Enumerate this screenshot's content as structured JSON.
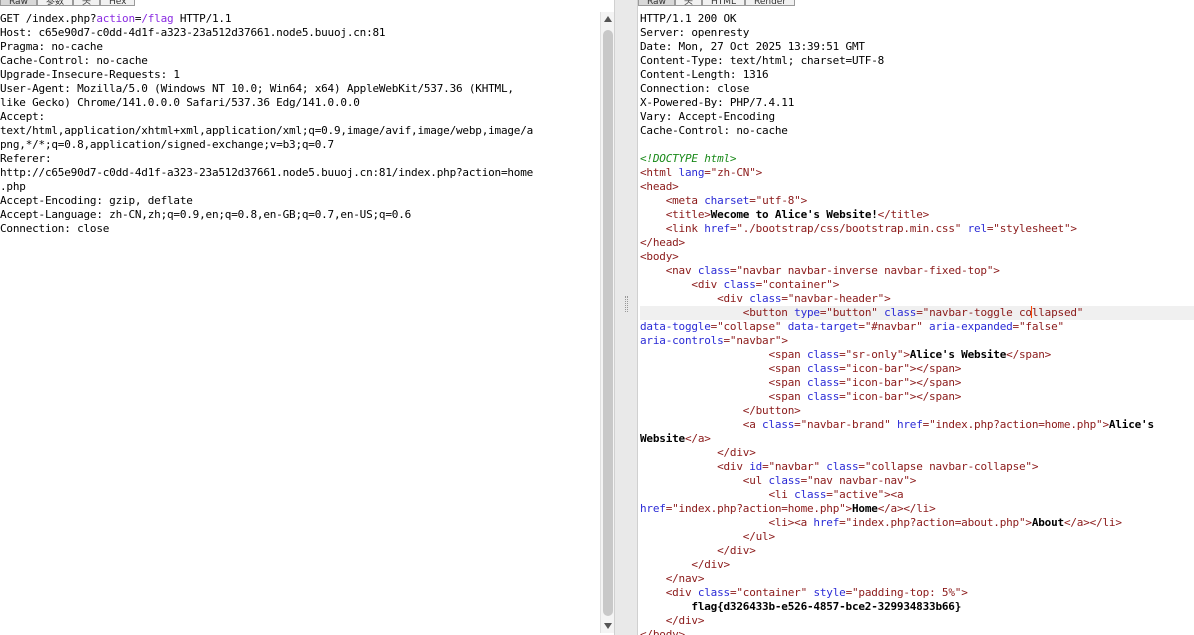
{
  "request_tabs": [
    "Raw",
    "参数",
    "头",
    "Hex"
  ],
  "response_tabs": [
    "Raw",
    "头",
    "HTML",
    "Render"
  ],
  "request_lines": [
    {
      "segments": [
        {
          "t": "GET /index.php?"
        },
        {
          "t": "action",
          "c": "param"
        },
        {
          "t": "="
        },
        {
          "t": "/flag",
          "c": "param"
        },
        {
          "t": " HTTP/1.1"
        }
      ]
    },
    {
      "segments": [
        {
          "t": "Host: c65e90d7-c0dd-4d1f-a323-23a512d37661.node5.buuoj.cn:81"
        }
      ]
    },
    {
      "segments": [
        {
          "t": "Pragma: no-cache"
        }
      ]
    },
    {
      "segments": [
        {
          "t": "Cache-Control: no-cache"
        }
      ]
    },
    {
      "segments": [
        {
          "t": "Upgrade-Insecure-Requests: 1"
        }
      ]
    },
    {
      "segments": [
        {
          "t": "User-Agent: Mozilla/5.0 (Windows NT 10.0; Win64; x64) AppleWebKit/537.36 (KHTML,"
        }
      ]
    },
    {
      "segments": [
        {
          "t": "like Gecko) Chrome/141.0.0.0 Safari/537.36 Edg/141.0.0.0"
        }
      ]
    },
    {
      "segments": [
        {
          "t": "Accept:"
        }
      ]
    },
    {
      "segments": [
        {
          "t": "text/html,application/xhtml+xml,application/xml;q=0.9,image/avif,image/webp,image/a"
        }
      ]
    },
    {
      "segments": [
        {
          "t": "png,*/*;q=0.8,application/signed-exchange;v=b3;q=0.7"
        }
      ]
    },
    {
      "segments": [
        {
          "t": "Referer:"
        }
      ]
    },
    {
      "segments": [
        {
          "t": "http://c65e90d7-c0dd-4d1f-a323-23a512d37661.node5.buuoj.cn:81/index.php?action=home"
        }
      ]
    },
    {
      "segments": [
        {
          "t": ".php"
        }
      ]
    },
    {
      "segments": [
        {
          "t": "Accept-Encoding: gzip, deflate"
        }
      ]
    },
    {
      "segments": [
        {
          "t": "Accept-Language: zh-CN,zh;q=0.9,en;q=0.8,en-GB;q=0.7,en-US;q=0.6"
        }
      ]
    },
    {
      "segments": [
        {
          "t": "Connection: close"
        }
      ]
    }
  ],
  "response_lines": [
    {
      "segments": [
        {
          "t": "HTTP/1.1 200 OK"
        }
      ]
    },
    {
      "segments": [
        {
          "t": "Server: openresty"
        }
      ]
    },
    {
      "segments": [
        {
          "t": "Date: Mon, 27 Oct 2025 13:39:51 GMT"
        }
      ]
    },
    {
      "segments": [
        {
          "t": "Content-Type: text/html; charset=UTF-8"
        }
      ]
    },
    {
      "segments": [
        {
          "t": "Content-Length: 1316"
        }
      ]
    },
    {
      "segments": [
        {
          "t": "Connection: close"
        }
      ]
    },
    {
      "segments": [
        {
          "t": "X-Powered-By: PHP/7.4.11"
        }
      ]
    },
    {
      "segments": [
        {
          "t": "Vary: Accept-Encoding"
        }
      ]
    },
    {
      "segments": [
        {
          "t": "Cache-Control: no-cache"
        }
      ]
    },
    {
      "segments": [
        {
          "t": ""
        }
      ]
    },
    {
      "segments": [
        {
          "t": "<!DOCTYPE html>",
          "c": "doctype"
        }
      ]
    },
    {
      "segments": [
        {
          "t": "<html ",
          "c": "tag"
        },
        {
          "t": "lang",
          "c": "attr"
        },
        {
          "t": "=\"zh-CN\"",
          "c": "str"
        },
        {
          "t": ">",
          "c": "tag"
        }
      ]
    },
    {
      "segments": [
        {
          "t": "<head>",
          "c": "tag"
        }
      ]
    },
    {
      "segments": [
        {
          "t": "    "
        },
        {
          "t": "<meta ",
          "c": "tag"
        },
        {
          "t": "charset",
          "c": "attr"
        },
        {
          "t": "=\"utf-8\"",
          "c": "str"
        },
        {
          "t": ">",
          "c": "tag"
        }
      ]
    },
    {
      "segments": [
        {
          "t": "    "
        },
        {
          "t": "<title>",
          "c": "tag"
        },
        {
          "t": "Wecome to Alice's Website!",
          "c": "bold"
        },
        {
          "t": "</title>",
          "c": "tag"
        }
      ]
    },
    {
      "segments": [
        {
          "t": "    "
        },
        {
          "t": "<link ",
          "c": "tag"
        },
        {
          "t": "href",
          "c": "attr"
        },
        {
          "t": "=\"./bootstrap/css/bootstrap.min.css\" ",
          "c": "str"
        },
        {
          "t": "rel",
          "c": "attr"
        },
        {
          "t": "=\"stylesheet\"",
          "c": "str"
        },
        {
          "t": ">",
          "c": "tag"
        }
      ]
    },
    {
      "segments": [
        {
          "t": "</head>",
          "c": "tag"
        }
      ]
    },
    {
      "segments": [
        {
          "t": "<body>",
          "c": "tag"
        }
      ]
    },
    {
      "segments": [
        {
          "t": "    "
        },
        {
          "t": "<nav ",
          "c": "tag"
        },
        {
          "t": "class",
          "c": "attr"
        },
        {
          "t": "=\"navbar navbar-inverse navbar-fixed-top\"",
          "c": "str"
        },
        {
          "t": ">",
          "c": "tag"
        }
      ]
    },
    {
      "segments": [
        {
          "t": "        "
        },
        {
          "t": "<div ",
          "c": "tag"
        },
        {
          "t": "class",
          "c": "attr"
        },
        {
          "t": "=\"container\"",
          "c": "str"
        },
        {
          "t": ">",
          "c": "tag"
        }
      ]
    },
    {
      "segments": [
        {
          "t": "            "
        },
        {
          "t": "<div ",
          "c": "tag"
        },
        {
          "t": "class",
          "c": "attr"
        },
        {
          "t": "=\"navbar-header\"",
          "c": "str"
        },
        {
          "t": ">",
          "c": "tag"
        }
      ]
    },
    {
      "hl": true,
      "segments": [
        {
          "t": "                "
        },
        {
          "t": "<button ",
          "c": "tag"
        },
        {
          "t": "type",
          "c": "attr"
        },
        {
          "t": "=\"button\" ",
          "c": "str"
        },
        {
          "t": "class",
          "c": "attr"
        },
        {
          "t": "=\"navbar-toggle co",
          "c": "str"
        },
        {
          "caret": true
        },
        {
          "t": "llapsed\"",
          "c": "str"
        }
      ]
    },
    {
      "segments": [
        {
          "t": "data-toggle",
          "c": "attr"
        },
        {
          "t": "=\"collapse\" ",
          "c": "str"
        },
        {
          "t": "data-target",
          "c": "attr"
        },
        {
          "t": "=\"#navbar\" ",
          "c": "str"
        },
        {
          "t": "aria-expanded",
          "c": "attr"
        },
        {
          "t": "=\"false\"",
          "c": "str"
        }
      ]
    },
    {
      "segments": [
        {
          "t": "aria-controls",
          "c": "attr"
        },
        {
          "t": "=\"navbar\"",
          "c": "str"
        },
        {
          "t": ">",
          "c": "tag"
        }
      ]
    },
    {
      "segments": [
        {
          "t": "                    "
        },
        {
          "t": "<span ",
          "c": "tag"
        },
        {
          "t": "class",
          "c": "attr"
        },
        {
          "t": "=\"sr-only\"",
          "c": "str"
        },
        {
          "t": ">",
          "c": "tag"
        },
        {
          "t": "Alice's Website",
          "c": "bold"
        },
        {
          "t": "</span>",
          "c": "tag"
        }
      ]
    },
    {
      "segments": [
        {
          "t": "                    "
        },
        {
          "t": "<span ",
          "c": "tag"
        },
        {
          "t": "class",
          "c": "attr"
        },
        {
          "t": "=\"icon-bar\"",
          "c": "str"
        },
        {
          "t": "></span>",
          "c": "tag"
        }
      ]
    },
    {
      "segments": [
        {
          "t": "                    "
        },
        {
          "t": "<span ",
          "c": "tag"
        },
        {
          "t": "class",
          "c": "attr"
        },
        {
          "t": "=\"icon-bar\"",
          "c": "str"
        },
        {
          "t": "></span>",
          "c": "tag"
        }
      ]
    },
    {
      "segments": [
        {
          "t": "                    "
        },
        {
          "t": "<span ",
          "c": "tag"
        },
        {
          "t": "class",
          "c": "attr"
        },
        {
          "t": "=\"icon-bar\"",
          "c": "str"
        },
        {
          "t": "></span>",
          "c": "tag"
        }
      ]
    },
    {
      "segments": [
        {
          "t": "                "
        },
        {
          "t": "</button>",
          "c": "tag"
        }
      ]
    },
    {
      "segments": [
        {
          "t": "                "
        },
        {
          "t": "<a ",
          "c": "tag"
        },
        {
          "t": "class",
          "c": "attr"
        },
        {
          "t": "=\"navbar-brand\" ",
          "c": "str"
        },
        {
          "t": "href",
          "c": "attr"
        },
        {
          "t": "=\"index.php?action=home.php\"",
          "c": "str"
        },
        {
          "t": ">",
          "c": "tag"
        },
        {
          "t": "Alice's",
          "c": "bold"
        }
      ]
    },
    {
      "segments": [
        {
          "t": "Website",
          "c": "bold"
        },
        {
          "t": "</a>",
          "c": "tag"
        }
      ]
    },
    {
      "segments": [
        {
          "t": "            "
        },
        {
          "t": "</div>",
          "c": "tag"
        }
      ]
    },
    {
      "segments": [
        {
          "t": "            "
        },
        {
          "t": "<div ",
          "c": "tag"
        },
        {
          "t": "id",
          "c": "attr"
        },
        {
          "t": "=\"navbar\" ",
          "c": "str"
        },
        {
          "t": "class",
          "c": "attr"
        },
        {
          "t": "=\"collapse navbar-collapse\"",
          "c": "str"
        },
        {
          "t": ">",
          "c": "tag"
        }
      ]
    },
    {
      "segments": [
        {
          "t": "                "
        },
        {
          "t": "<ul ",
          "c": "tag"
        },
        {
          "t": "class",
          "c": "attr"
        },
        {
          "t": "=\"nav navbar-nav\"",
          "c": "str"
        },
        {
          "t": ">",
          "c": "tag"
        }
      ]
    },
    {
      "segments": [
        {
          "t": "                    "
        },
        {
          "t": "<li ",
          "c": "tag"
        },
        {
          "t": "class",
          "c": "attr"
        },
        {
          "t": "=\"active\"",
          "c": "str"
        },
        {
          "t": "><a",
          "c": "tag"
        }
      ]
    },
    {
      "segments": [
        {
          "t": "href",
          "c": "attr"
        },
        {
          "t": "=\"index.php?action=home.php\"",
          "c": "str"
        },
        {
          "t": ">",
          "c": "tag"
        },
        {
          "t": "Home",
          "c": "bold"
        },
        {
          "t": "</a></li>",
          "c": "tag"
        }
      ]
    },
    {
      "segments": [
        {
          "t": "                    "
        },
        {
          "t": "<li><a ",
          "c": "tag"
        },
        {
          "t": "href",
          "c": "attr"
        },
        {
          "t": "=\"index.php?action=about.php\"",
          "c": "str"
        },
        {
          "t": ">",
          "c": "tag"
        },
        {
          "t": "About",
          "c": "bold"
        },
        {
          "t": "</a></li>",
          "c": "tag"
        }
      ]
    },
    {
      "segments": [
        {
          "t": "                "
        },
        {
          "t": "</ul>",
          "c": "tag"
        }
      ]
    },
    {
      "segments": [
        {
          "t": "            "
        },
        {
          "t": "</div>",
          "c": "tag"
        }
      ]
    },
    {
      "segments": [
        {
          "t": "        "
        },
        {
          "t": "</div>",
          "c": "tag"
        }
      ]
    },
    {
      "segments": [
        {
          "t": "    "
        },
        {
          "t": "</nav>",
          "c": "tag"
        }
      ]
    },
    {
      "segments": [
        {
          "t": "    "
        },
        {
          "t": "<div ",
          "c": "tag"
        },
        {
          "t": "class",
          "c": "attr"
        },
        {
          "t": "=\"container\" ",
          "c": "str"
        },
        {
          "t": "style",
          "c": "attr"
        },
        {
          "t": "=\"padding-top: 5%\"",
          "c": "str"
        },
        {
          "t": ">",
          "c": "tag"
        }
      ]
    },
    {
      "segments": [
        {
          "t": "        "
        },
        {
          "t": "flag{d326433b-e526-4857-bce2-329934833b66}",
          "c": "bold"
        }
      ]
    },
    {
      "segments": [
        {
          "t": "    "
        },
        {
          "t": "</div>",
          "c": "tag"
        }
      ]
    },
    {
      "segments": [
        {
          "t": "</body>",
          "c": "tag"
        }
      ]
    }
  ]
}
